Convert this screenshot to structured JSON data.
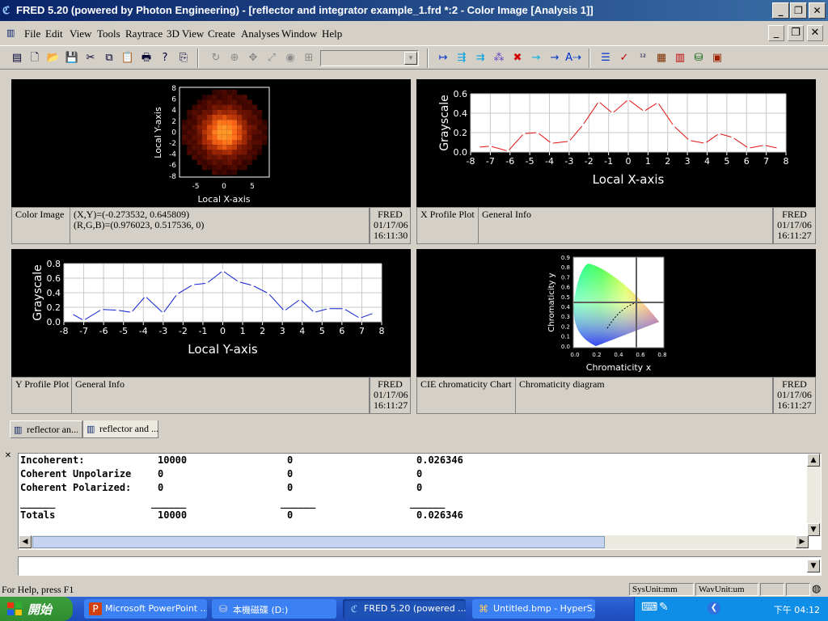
{
  "window": {
    "title": "FRED 5.20 (powered by Photon Engineering) - [reflector and integrator example_1.frd *:2 - Color Image    [Analysis 1]]"
  },
  "menu": [
    "File",
    "Edit",
    "View",
    "Tools",
    "Raytrace",
    "3D View",
    "Create",
    "Analyses",
    "Window",
    "Help"
  ],
  "panels": {
    "color_image": {
      "xlabel": "Local X-axis",
      "ylabel": "Local Y-axis",
      "xticks": [
        "-5",
        "0",
        "5"
      ],
      "yticks": [
        "8",
        "6",
        "4",
        "2",
        "0",
        "-2",
        "-4",
        "-6",
        "-8"
      ],
      "info": {
        "name": "Color Image",
        "line1": "(X,Y)=(-0.273532, 0.645809)",
        "line2": "(R,G,B)=(0.976023, 0.517536, 0)",
        "stamp": [
          "FRED",
          "01/17/06",
          "16:11:30"
        ]
      }
    },
    "x_profile": {
      "info": {
        "name": "X Profile Plot",
        "desc": "General Info",
        "stamp": [
          "FRED",
          "01/17/06",
          "16:11:27"
        ]
      }
    },
    "y_profile": {
      "info": {
        "name": "Y Profile Plot",
        "desc": "General Info",
        "stamp": [
          "FRED",
          "01/17/06",
          "16:11:27"
        ]
      }
    },
    "cie": {
      "xlabel": "Chromaticity x",
      "ylabel": "Chromaticity y",
      "xticks": [
        "0.0",
        "0.2",
        "0.4",
        "0.6",
        "0.8"
      ],
      "yticks": [
        "0.9",
        "0.8",
        "0.7",
        "0.6",
        "0.5",
        "0.4",
        "0.3",
        "0.2",
        "0.1",
        "0.0"
      ],
      "info": {
        "name": "CIE chromaticity Chart",
        "desc": "Chromaticity diagram",
        "stamp": [
          "FRED",
          "01/17/06",
          "16:11:27"
        ]
      }
    }
  },
  "chart_data": [
    {
      "type": "line",
      "ylabel": "Grayscale",
      "xlabel": "Local X-axis",
      "xlim": [
        -8,
        8
      ],
      "ylim": [
        0,
        0.6
      ],
      "xticks": [
        -8,
        -7,
        -6,
        -5,
        -4,
        -3,
        -2,
        -1,
        0,
        1,
        2,
        3,
        4,
        5,
        6,
        7,
        8
      ],
      "yticks": [
        0.0,
        0.2,
        0.4,
        0.6
      ],
      "color": "#e01010",
      "x": [
        -7.6,
        -7.0,
        -6.1,
        -5.3,
        -4.6,
        -3.9,
        -3.0,
        -2.3,
        -1.5,
        -0.8,
        0.0,
        0.8,
        1.5,
        2.3,
        3.1,
        3.9,
        4.6,
        5.3,
        6.1,
        6.9,
        7.6
      ],
      "y": [
        0.05,
        0.06,
        0.01,
        0.19,
        0.2,
        0.09,
        0.11,
        0.28,
        0.52,
        0.4,
        0.54,
        0.42,
        0.51,
        0.27,
        0.12,
        0.09,
        0.19,
        0.15,
        0.04,
        0.07,
        0.04
      ]
    },
    {
      "type": "line",
      "ylabel": "Grayscale",
      "xlabel": "Local Y-axis",
      "xlim": [
        -8,
        8
      ],
      "ylim": [
        0,
        0.8
      ],
      "xticks": [
        -8,
        -7,
        -6,
        -5,
        -4,
        -3,
        -2,
        -1,
        0,
        1,
        2,
        3,
        4,
        5,
        6,
        7,
        8
      ],
      "yticks": [
        0.0,
        0.2,
        0.4,
        0.6,
        0.8
      ],
      "color": "#1020d0",
      "x": [
        -7.6,
        -7.0,
        -6.1,
        -5.3,
        -4.6,
        -3.9,
        -3.0,
        -2.3,
        -1.5,
        -0.8,
        0.0,
        0.8,
        1.5,
        2.3,
        3.1,
        3.9,
        4.6,
        5.3,
        6.1,
        6.9,
        7.6
      ],
      "y": [
        0.11,
        0.02,
        0.17,
        0.16,
        0.13,
        0.35,
        0.12,
        0.38,
        0.51,
        0.53,
        0.7,
        0.55,
        0.5,
        0.39,
        0.15,
        0.31,
        0.13,
        0.18,
        0.18,
        0.05,
        0.12
      ]
    }
  ],
  "tabs": [
    {
      "label": "reflector an..."
    },
    {
      "label": "reflector and ..."
    }
  ],
  "output": {
    "rows": [
      {
        "label": "Incoherent:",
        "c1": "10000",
        "c2": "0",
        "c3": "0.026346"
      },
      {
        "label": "Coherent Unpolarize",
        "c1": "0",
        "c2": "0",
        "c3": "0"
      },
      {
        "label": "Coherent Polarized:",
        "c1": "0",
        "c2": "0",
        "c3": "0"
      }
    ],
    "rule": "______",
    "totals": {
      "label": "Totals",
      "c1": "10000",
      "c2": "0",
      "c3": "0.026346"
    }
  },
  "status": {
    "help": "For Help, press F1",
    "sysunit": "SysUnit:mm",
    "wavunit": "WavUnit:um"
  },
  "taskbar": {
    "start": "開始",
    "items": [
      {
        "label": "Microsoft PowerPoint ..."
      },
      {
        "label": "本機磁碟 (D:)"
      },
      {
        "label": "FRED 5.20 (powered ..."
      },
      {
        "label": "Untitled.bmp - HyperS..."
      }
    ],
    "clock": "下午 04:12"
  },
  "colors": {
    "titlebar": "#0a246a",
    "xprofile_line": "#e01010",
    "yprofile_line": "#1020d0"
  }
}
